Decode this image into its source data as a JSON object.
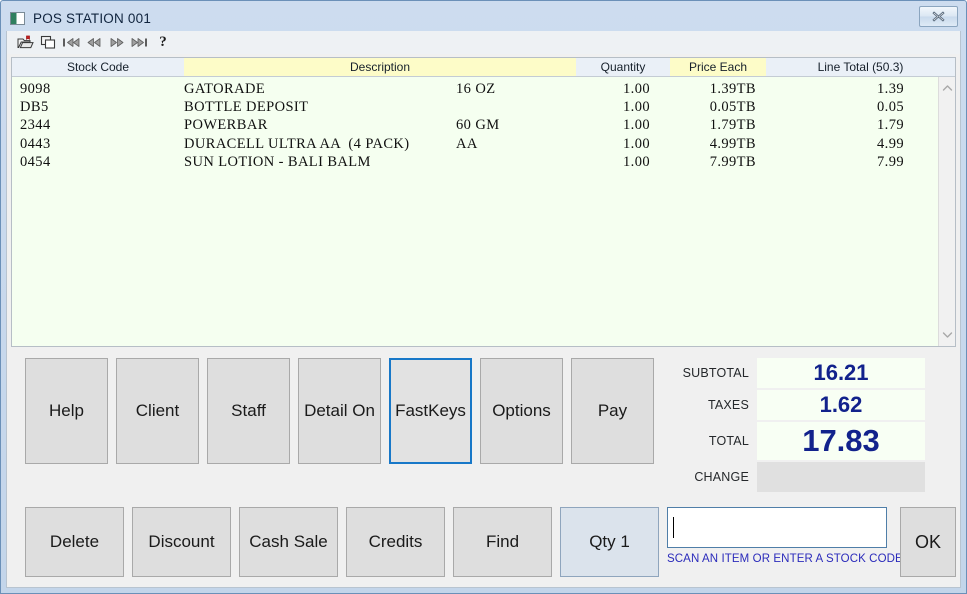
{
  "window": {
    "title": "POS STATION 001",
    "app_icon": "pos-app-icon",
    "close_label": "Close"
  },
  "toolbar": {
    "items": [
      {
        "name": "open-folder-icon",
        "label": "Open"
      },
      {
        "name": "duplicate-icon",
        "label": "Duplicate"
      },
      {
        "name": "first-record-icon",
        "label": "First"
      },
      {
        "name": "previous-record-icon",
        "label": "Previous"
      },
      {
        "name": "next-record-icon",
        "label": "Next"
      },
      {
        "name": "last-record-icon",
        "label": "Last"
      },
      {
        "name": "help-icon",
        "label": "?"
      }
    ],
    "help_glyph": "?"
  },
  "grid": {
    "columns": [
      {
        "label": "Stock Code",
        "highlight": "blue"
      },
      {
        "label": "Description",
        "highlight": "yellow"
      },
      {
        "label": "Quantity",
        "highlight": "blue"
      },
      {
        "label": "Price Each",
        "highlight": "yellow"
      },
      {
        "label": "Line Total (50.3)",
        "highlight": "blue"
      }
    ],
    "rows": [
      {
        "stock_code": "9098",
        "description": "GATORADE",
        "size": "16 OZ",
        "quantity": "1.00",
        "price_each": "1.39TB",
        "line_total": "1.39"
      },
      {
        "stock_code": "DB5",
        "description": "BOTTLE DEPOSIT",
        "size": "",
        "quantity": "1.00",
        "price_each": "0.05TB",
        "line_total": "0.05"
      },
      {
        "stock_code": "2344",
        "description": "POWERBAR",
        "size": "60 GM",
        "quantity": "1.00",
        "price_each": "1.79TB",
        "line_total": "1.79"
      },
      {
        "stock_code": "0443",
        "description": "DURACELL ULTRA AA  (4 PACK)",
        "size": "AA",
        "quantity": "1.00",
        "price_each": "4.99TB",
        "line_total": "4.99"
      },
      {
        "stock_code": "0454",
        "description": "SUN LOTION - BALI BALM",
        "size": "",
        "quantity": "1.00",
        "price_each": "7.99TB",
        "line_total": "7.99"
      }
    ],
    "scrollbar": {
      "up_icon": "chevron-up-icon",
      "down_icon": "chevron-down-icon"
    }
  },
  "function_buttons": [
    {
      "label": "Help",
      "name": "help-button",
      "focused": false
    },
    {
      "label": "Client",
      "name": "client-button",
      "focused": false
    },
    {
      "label": "Staff",
      "name": "staff-button",
      "focused": false
    },
    {
      "label": "Detail On",
      "name": "detail-on-button",
      "focused": false
    },
    {
      "label": "FastKeys",
      "name": "fastkeys-button",
      "focused": true
    },
    {
      "label": "Options",
      "name": "options-button",
      "focused": false
    },
    {
      "label": "Pay",
      "name": "pay-button",
      "focused": false
    }
  ],
  "totals": [
    {
      "label": "SUBTOTAL",
      "value": "16.21",
      "size": "normal"
    },
    {
      "label": "TAXES",
      "value": "1.62",
      "size": "normal"
    },
    {
      "label": "TOTAL",
      "value": "17.83",
      "size": "large"
    },
    {
      "label": "CHANGE",
      "value": "",
      "size": "normal"
    }
  ],
  "action_buttons": [
    {
      "label": "Delete",
      "name": "delete-button",
      "tinted": false
    },
    {
      "label": "Discount",
      "name": "discount-button",
      "tinted": false
    },
    {
      "label": "Cash Sale",
      "name": "cash-sale-button",
      "tinted": false
    },
    {
      "label": "Credits",
      "name": "credits-button",
      "tinted": false
    },
    {
      "label": "Find",
      "name": "find-button",
      "tinted": false
    },
    {
      "label": "Qty 1",
      "name": "qty-button",
      "tinted": true
    }
  ],
  "scan": {
    "value": "",
    "placeholder": "",
    "hint": "SCAN AN ITEM OR ENTER A STOCK CODE"
  },
  "ok_button": {
    "label": "OK"
  },
  "colors": {
    "accent_blue": "#1878c8",
    "total_text": "#12228c",
    "grid_background": "#f5fff0",
    "header_yellow": "#fdfcc8",
    "hint_blue": "#2b2bbb"
  }
}
